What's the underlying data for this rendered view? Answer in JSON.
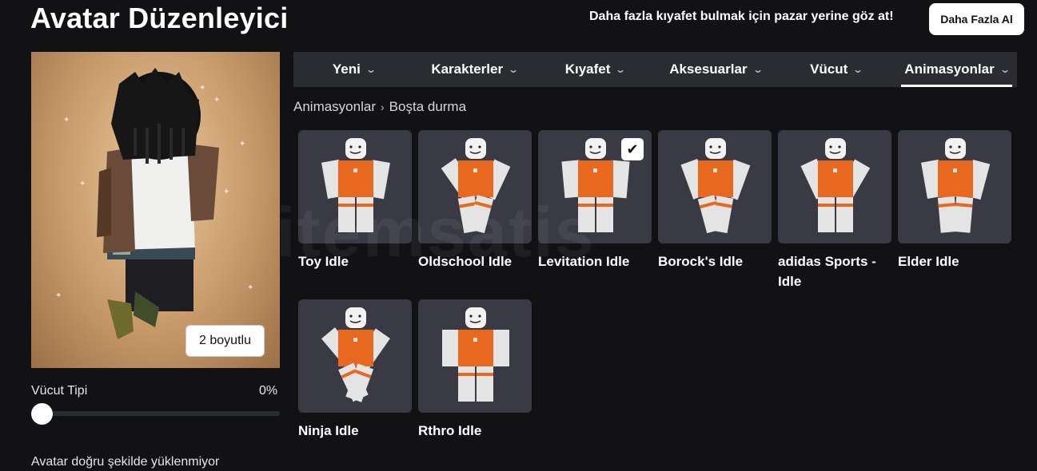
{
  "header": {
    "title": "Avatar Düzenleyici",
    "promo_text": "Daha fazla kıyafet bulmak için pazar yerine göz at!",
    "buy_more_label": "Daha Fazla Al"
  },
  "preview": {
    "toggle_label": "2 boyutlu"
  },
  "body_type": {
    "label": "Vücut Tipi",
    "value": "0%",
    "slider_level": 0
  },
  "loading_note": "Avatar doğru şekilde yüklenmiyor",
  "tabs": [
    {
      "label": "Yeni",
      "active": false
    },
    {
      "label": "Karakterler",
      "active": false
    },
    {
      "label": "Kıyafet",
      "active": false
    },
    {
      "label": "Aksesuarlar",
      "active": false
    },
    {
      "label": "Vücut",
      "active": false
    },
    {
      "label": "Animasyonlar",
      "active": true
    }
  ],
  "breadcrumb": {
    "parent": "Animasyonlar",
    "current": "Boşta durma"
  },
  "items": [
    {
      "name": "Toy Idle",
      "selected": false
    },
    {
      "name": "Oldschool Idle",
      "selected": false
    },
    {
      "name": "Levitation Idle",
      "selected": true
    },
    {
      "name": "Borock's Idle",
      "selected": false
    },
    {
      "name": "adidas Sports - Idle",
      "selected": false
    },
    {
      "name": "Elder Idle",
      "selected": false
    },
    {
      "name": "Ninja Idle",
      "selected": false
    },
    {
      "name": "Rthro Idle",
      "selected": false
    }
  ],
  "watermark": "itemsatis",
  "colors": {
    "background": "#121215",
    "tab_bar": "#2b2c31",
    "card": "#393a43",
    "shirt": "#e8681f"
  }
}
